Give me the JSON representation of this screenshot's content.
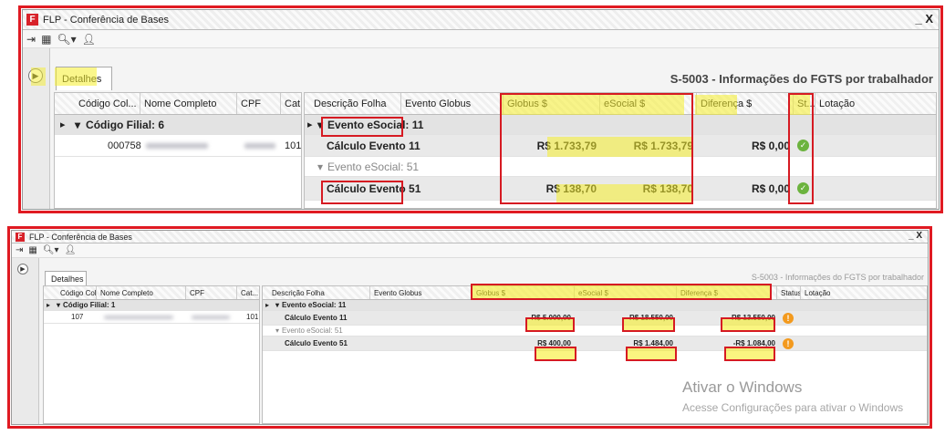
{
  "window1": {
    "logo": "F",
    "title": "FLP - Conferência de Bases",
    "close": "_ X",
    "tab": "Detalhes",
    "caption": "S-5003 - Informações do FGTS por trabalhador",
    "left_headers": [
      "Código Col...",
      "Nome Completo",
      "CPF",
      "Cat..."
    ],
    "right_headers": [
      "Descrição Folha",
      "Evento Globus",
      "Globus $",
      "eSocial $",
      "Diferença $",
      "St...",
      "Lotação"
    ],
    "group": "Código Filial: 6",
    "emp": {
      "code": "000758",
      "cat": "101"
    },
    "ev1": "Evento eSocial: 11",
    "calc1": "Cálculo Evento 11",
    "g1": "R$ 1.733,79",
    "e1": "R$ 1.733,79",
    "d1": "R$ 0,00",
    "ev2": "Evento eSocial: 51",
    "calc2": "Cálculo Evento 51",
    "g2": "R$ 138,70",
    "e2": "R$ 138,70",
    "d2": "R$ 0,00"
  },
  "window2": {
    "logo": "F",
    "title": "FLP - Conferência de Bases",
    "close": "_ X",
    "tab": "Detalhes",
    "caption": "S-5003 - Informações do FGTS por trabalhador",
    "left_headers": [
      "Código Col...",
      "Nome Completo",
      "CPF",
      "Cat..."
    ],
    "right_headers": [
      "Descrição Folha",
      "Evento Globus",
      "Globus $",
      "eSocial $",
      "Diferença $",
      "Status",
      "Lotação"
    ],
    "group": "Código Filial: 1",
    "emp": {
      "code": "107",
      "cat": "101"
    },
    "ev1": "Evento eSocial: 11",
    "calc1": "Cálculo Evento 11",
    "g1": "R$ 5.000,00",
    "e1": "R$ 18.550,00",
    "d1": "-R$ 13.550,00",
    "ev2": "Evento eSocial: 51",
    "calc2": "Cálculo Evento 51",
    "g2": "R$ 400,00",
    "e2": "R$ 1.484,00",
    "d2": "-R$ 1.084,00"
  },
  "watermark": {
    "line1": "Ativar o Windows",
    "line2": "Acesse Configurações para ativar o Windows"
  },
  "colors": {
    "highlight": "#f6ee2c",
    "annotation_border": "#e01a22",
    "ok": "#6cb33e",
    "warn": "#f39a1e"
  }
}
